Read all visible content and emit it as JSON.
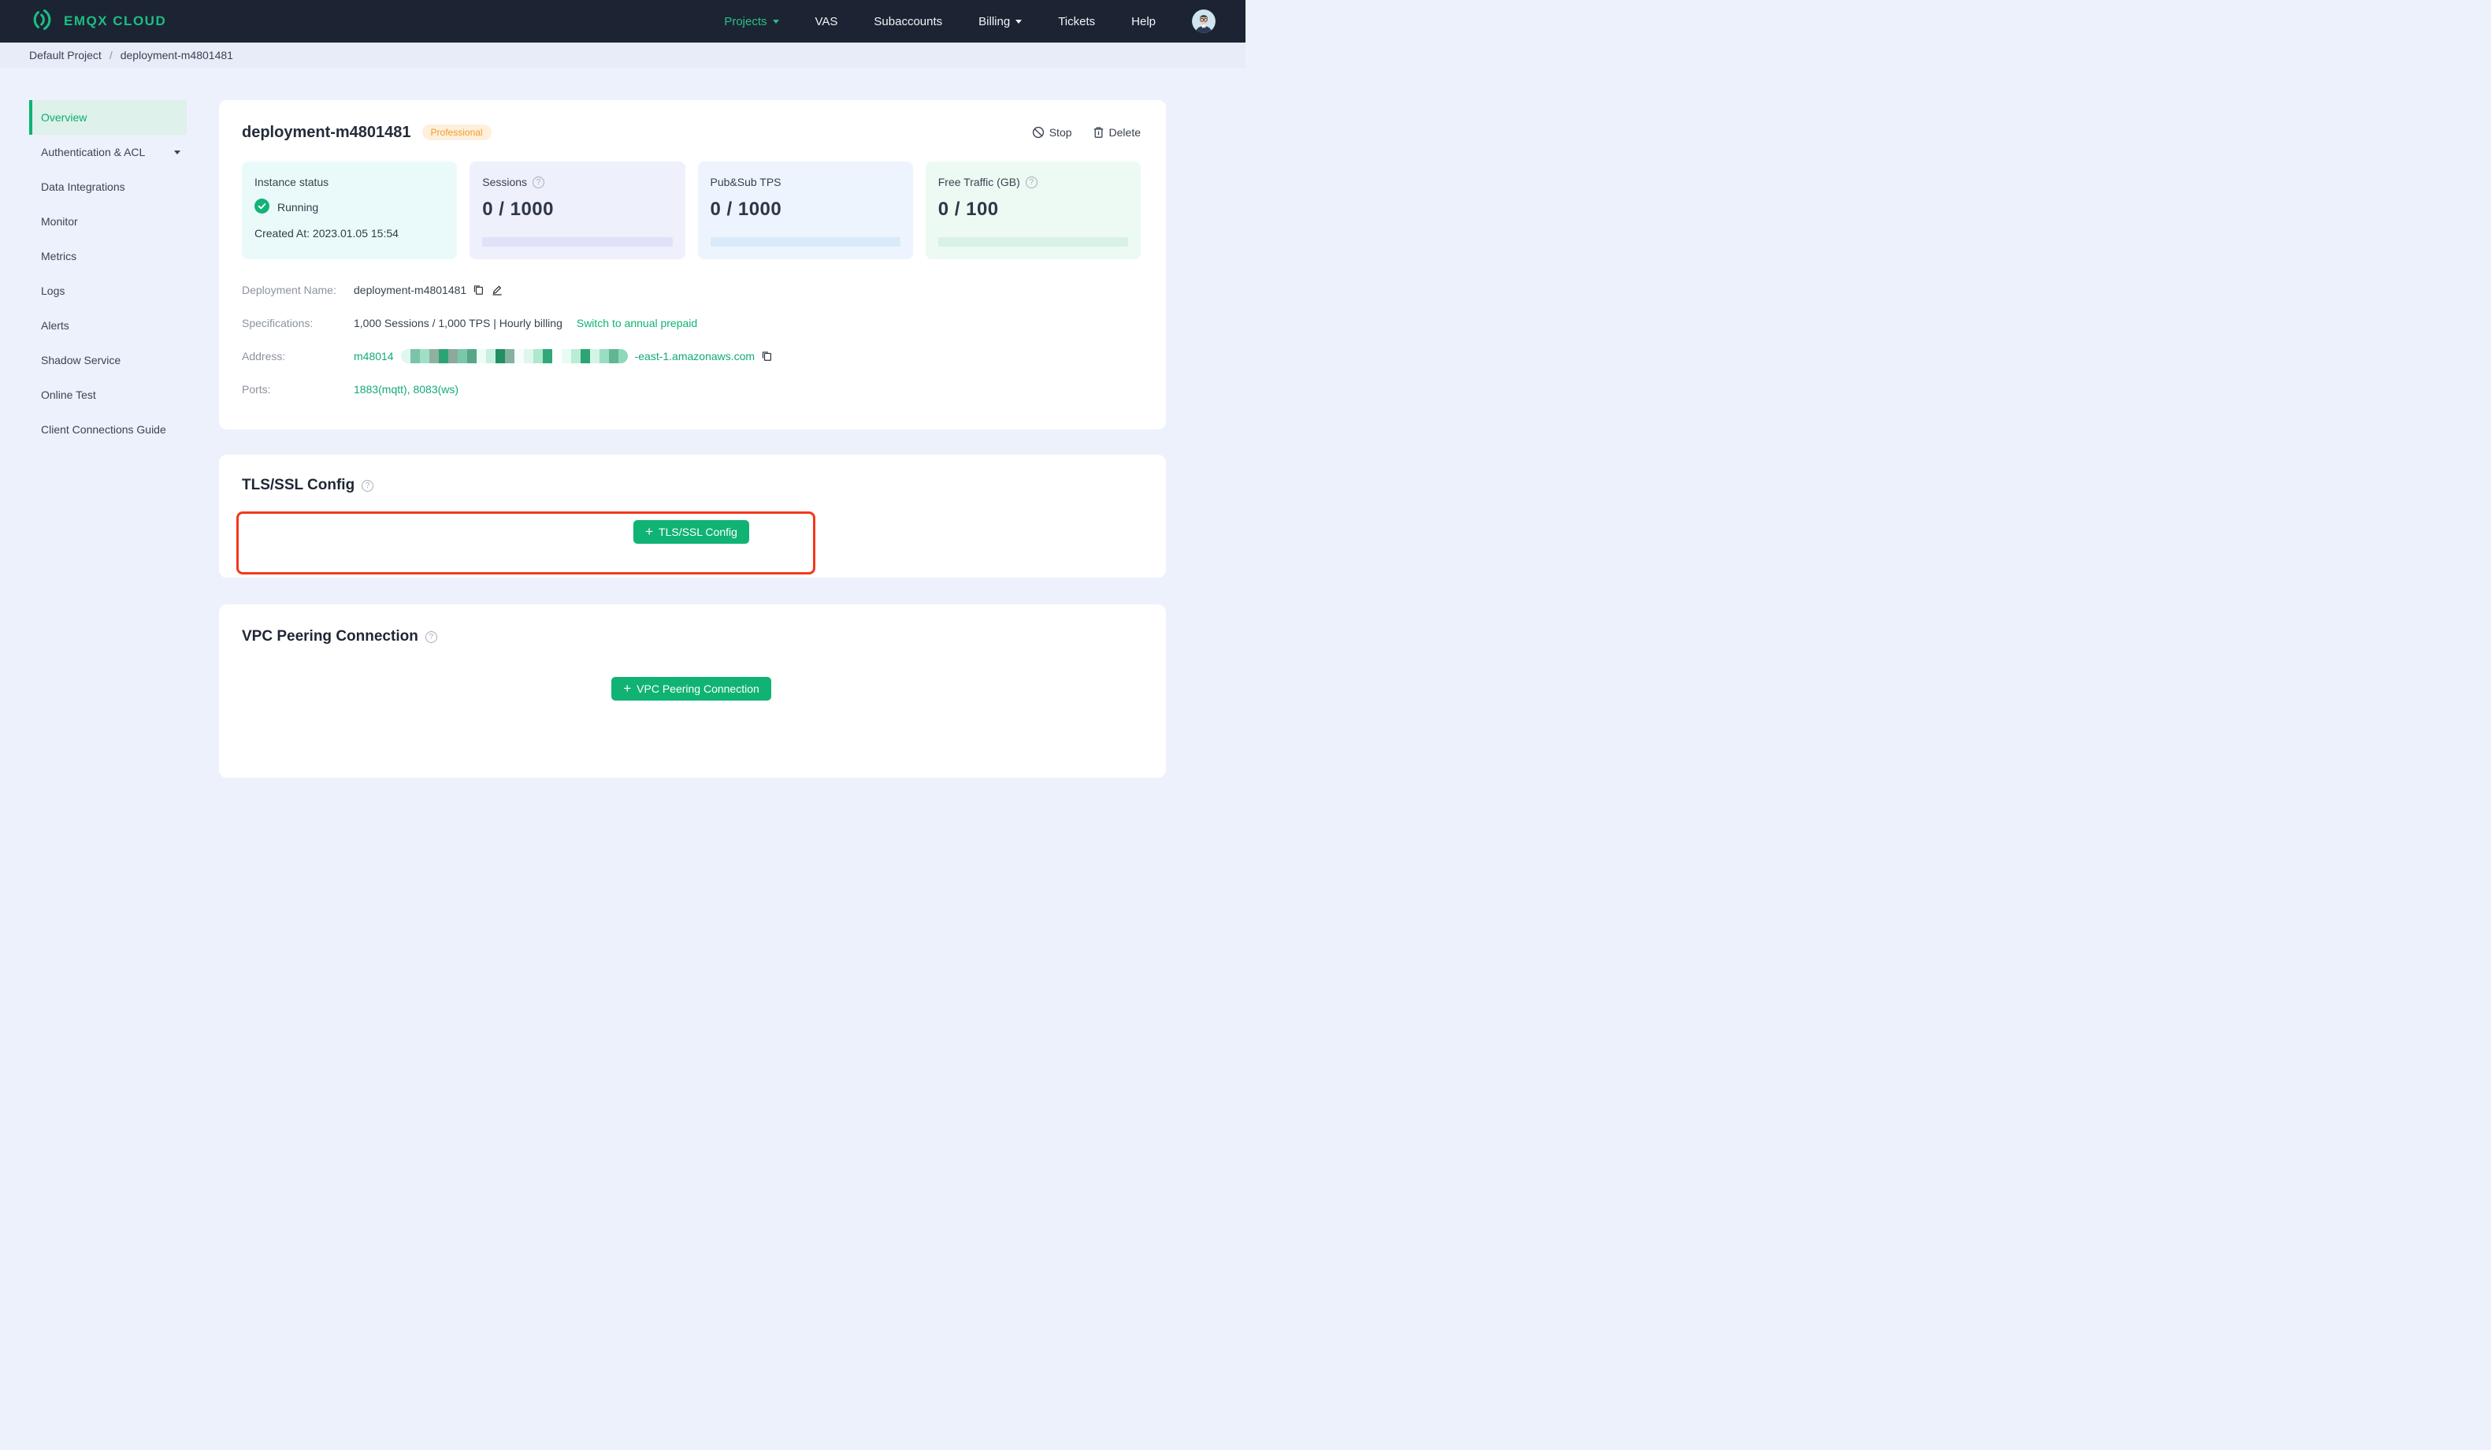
{
  "nav": {
    "brand": "EMQX CLOUD",
    "items": [
      {
        "label": "Projects",
        "active": true,
        "caret": true
      },
      {
        "label": "VAS"
      },
      {
        "label": "Subaccounts"
      },
      {
        "label": "Billing",
        "caret": true
      },
      {
        "label": "Tickets"
      },
      {
        "label": "Help"
      }
    ]
  },
  "breadcrumb": {
    "project": "Default Project",
    "separator": "/",
    "page": "deployment-m4801481"
  },
  "sidebar": {
    "items": [
      {
        "label": "Overview",
        "active": true
      },
      {
        "label": "Authentication & ACL",
        "caret": true
      },
      {
        "label": "Data Integrations"
      },
      {
        "label": "Monitor"
      },
      {
        "label": "Metrics"
      },
      {
        "label": "Logs"
      },
      {
        "label": "Alerts"
      },
      {
        "label": "Shadow Service"
      },
      {
        "label": "Online Test"
      },
      {
        "label": "Client Connections Guide"
      }
    ]
  },
  "deployment": {
    "title": "deployment-m4801481",
    "badge": "Professional",
    "stop_label": "Stop",
    "delete_label": "Delete",
    "stats": {
      "instance": {
        "label": "Instance status",
        "status": "Running",
        "created": "Created At: 2023.01.05 15:54"
      },
      "sessions": {
        "label": "Sessions",
        "value": "0 / 1000"
      },
      "tps": {
        "label": "Pub&Sub TPS",
        "value": "0 / 1000"
      },
      "traffic": {
        "label": "Free Traffic (GB)",
        "value": "0 / 100"
      }
    },
    "details": {
      "name_label": "Deployment Name:",
      "name_value": "deployment-m4801481",
      "spec_label": "Specifications:",
      "spec_value": "1,000 Sessions / 1,000 TPS | Hourly billing",
      "spec_link": "Switch to annual prepaid",
      "address_label": "Address:",
      "address_prefix": "m48014",
      "address_suffix": "-east-1.amazonaws.com",
      "ports_label": "Ports:",
      "ports_value": "1883(mqtt), 8083(ws)"
    }
  },
  "sections": {
    "tls": {
      "title": "TLS/SSL Config",
      "button": "TLS/SSL Config"
    },
    "vpc": {
      "title": "VPC Peering Connection",
      "button": "VPC Peering Connection"
    }
  },
  "redaction": {
    "blocks": [
      "#dff7ee",
      "#7cc3a9",
      "#9fe0c4",
      "#8fb1a2",
      "#2ba475",
      "#8caa9c",
      "#79c9a9",
      "#57a687",
      "#eefcf7",
      "#c6f0df",
      "#228f62",
      "#85b2a0",
      "#f7fdfb",
      "#dff6ec",
      "#ace9cd",
      "#30a878",
      "#ffffff",
      "#e8fbf4",
      "#baecd6",
      "#2ea475",
      "#d4f4e6",
      "#9adec2",
      "#63b494",
      "#8fd9ba"
    ]
  },
  "colors": {
    "nav_bg": "#1c2433",
    "accent_green": "#10b373",
    "brand_green": "#1dbd84",
    "badge_orange": "#f59a23",
    "annotation_red": "#f5381c",
    "running_green": "#12b377"
  }
}
